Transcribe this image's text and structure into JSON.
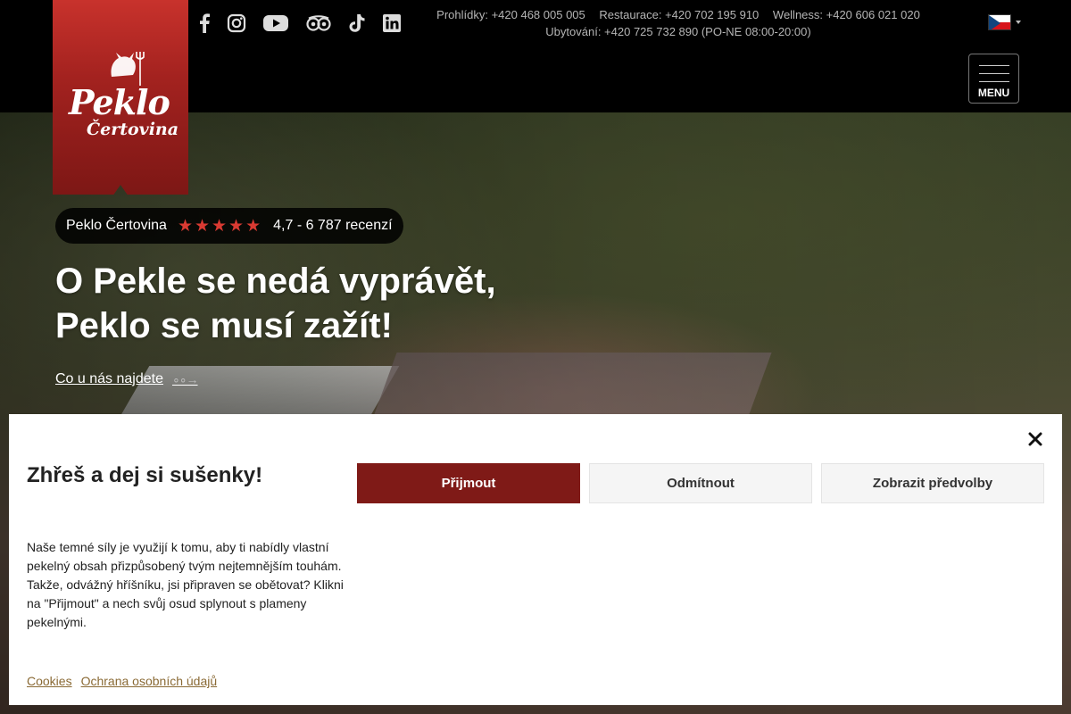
{
  "brand": {
    "logo_line1": "Peklo",
    "logo_line2": "Čertovina"
  },
  "socials": [
    "facebook-icon",
    "instagram-icon",
    "youtube-icon",
    "tripadvisor-icon",
    "tiktok-icon",
    "linkedin-icon"
  ],
  "contacts": {
    "line1": [
      "Prohlídky: +420 468 005 005",
      "Restaurace: +420 702 195 910",
      "Wellness: +420 606 021 020"
    ],
    "line2": "Ubytování: +420 725 732 890  (PO-NE 08:00-20:00)"
  },
  "language": {
    "selected": "cz-flag",
    "caret": "caret-down-icon"
  },
  "menu": {
    "label": "MENU"
  },
  "hero": {
    "rating_name": "Peklo Čertovina",
    "stars": "★★★★★",
    "rating_text": "4,7 - 6 787 recenzí",
    "headline_line1": "O Pekle se nedá vyprávět,",
    "headline_line2": "Peklo se musí zažít!",
    "cta": "Co u nás najdete",
    "cta_arrow": "∘∘→"
  },
  "cookie": {
    "title": "Zhřeš a dej si sušenky!",
    "text": "Naše temné síly je využijí k tomu, aby ti nabídly vlastní pekelný obsah přizpůsobený tvým nejtemnějším touhám. Takže, odvážný hříšníku, jsi připraven se obětovat? Klikni na \"Přijmout\" a nech svůj osud splynout s plameny pekelnými.",
    "accept": "Přijmout",
    "decline": "Odmítnout",
    "preferences": "Zobrazit předvolby",
    "links": [
      "Cookies",
      "Ochrana osobních údajů"
    ]
  },
  "colors": {
    "accent": "#7f1a17",
    "logo_red": "#c8322c",
    "star_red": "#d93a32",
    "link_brown": "#8a6a35"
  }
}
